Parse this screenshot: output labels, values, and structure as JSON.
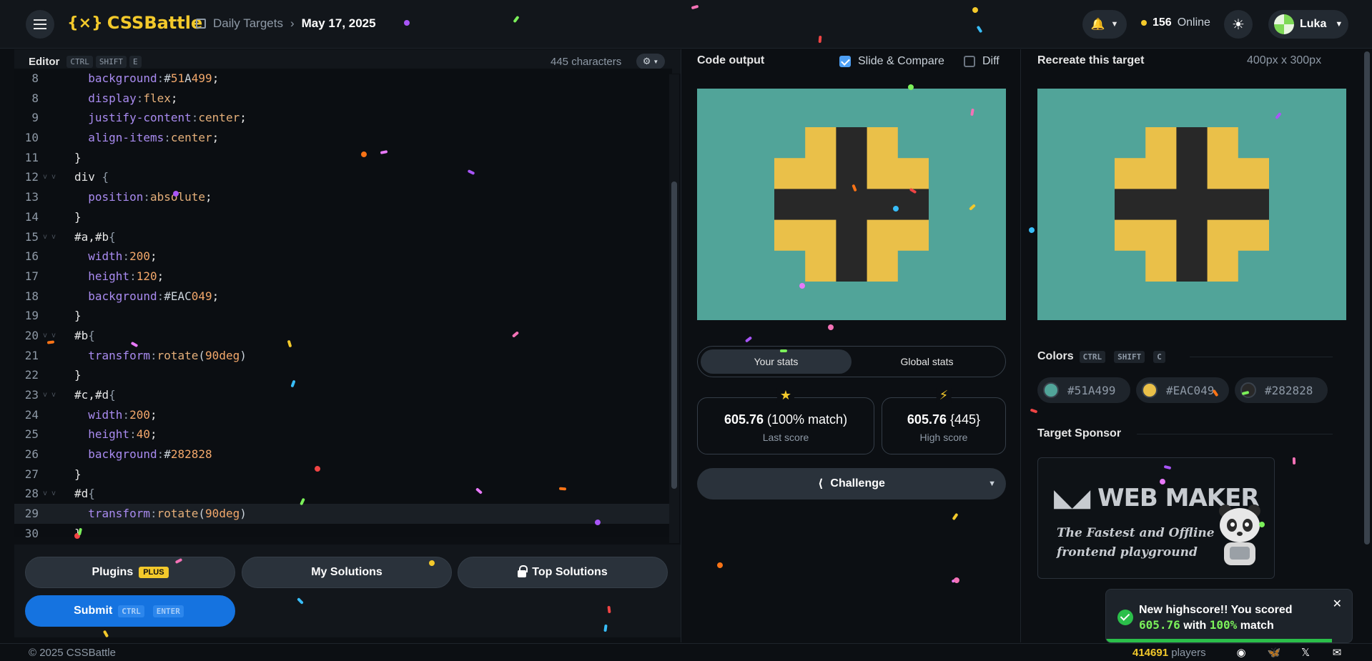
{
  "header": {
    "logo": "CSSBattle",
    "logo_mark": "{⨯}",
    "breadcrumb_section": "Daily Targets",
    "breadcrumb_date": "May 17, 2025",
    "online_count": "156",
    "online_label": "Online",
    "user_name": "Luka"
  },
  "editor": {
    "title": "Editor",
    "shortcut": [
      "CTRL",
      "SHIFT",
      "E"
    ],
    "characters": "445 characters",
    "lines": [
      {
        "n": "8",
        "text": "  background:#51A499;",
        "fold": ""
      },
      {
        "n": "8",
        "text": "  display:flex;",
        "fold": ""
      },
      {
        "n": "9",
        "text": "  justify-content:center;",
        "fold": ""
      },
      {
        "n": "10",
        "text": "  align-items:center;",
        "fold": ""
      },
      {
        "n": "11",
        "text": "}",
        "fold": ""
      },
      {
        "n": "12",
        "text": "div {",
        "fold": "v v"
      },
      {
        "n": "13",
        "text": "  position:absolute;",
        "fold": ""
      },
      {
        "n": "14",
        "text": "}",
        "fold": ""
      },
      {
        "n": "15",
        "text": "#a,#b{",
        "fold": "v v"
      },
      {
        "n": "16",
        "text": "  width:200;",
        "fold": ""
      },
      {
        "n": "17",
        "text": "  height:120;",
        "fold": ""
      },
      {
        "n": "18",
        "text": "  background:#EAC049;",
        "fold": ""
      },
      {
        "n": "19",
        "text": "}",
        "fold": ""
      },
      {
        "n": "20",
        "text": "#b{",
        "fold": "v v"
      },
      {
        "n": "21",
        "text": "  transform:rotate(90deg)",
        "fold": ""
      },
      {
        "n": "22",
        "text": "}",
        "fold": ""
      },
      {
        "n": "23",
        "text": "#c,#d{",
        "fold": "v v"
      },
      {
        "n": "24",
        "text": "  width:200;",
        "fold": ""
      },
      {
        "n": "25",
        "text": "  height:40;",
        "fold": ""
      },
      {
        "n": "26",
        "text": "  background:#282828",
        "fold": ""
      },
      {
        "n": "27",
        "text": "}",
        "fold": ""
      },
      {
        "n": "28",
        "text": "#d{",
        "fold": "v v"
      },
      {
        "n": "29",
        "text": "  transform:rotate(90deg)",
        "fold": ""
      },
      {
        "n": "30",
        "text": "}",
        "fold": ""
      }
    ],
    "active_line": "29"
  },
  "actions": {
    "plugins": "Plugins",
    "plugins_badge": "PLUS",
    "my_solutions": "My Solutions",
    "top_solutions": "Top Solutions",
    "submit": "Submit",
    "submit_shortcut": [
      "CTRL",
      "ENTER"
    ]
  },
  "output": {
    "title": "Code output",
    "slide_compare": "Slide & Compare",
    "diff": "Diff",
    "tab_your": "Your stats",
    "tab_global": "Global stats",
    "last_score_value": "605.76",
    "last_score_match": "(100% match)",
    "last_score_label": "Last score",
    "high_score_value": "605.76",
    "high_score_chars": "{445}",
    "high_score_label": "High score",
    "challenge": "Challenge"
  },
  "target": {
    "title": "Recreate this target",
    "dimensions": "400px x 300px",
    "colors_title": "Colors",
    "colors_shortcut": [
      "CTRL",
      "SHIFT",
      "C"
    ],
    "colors": [
      {
        "hex": "#51A499",
        "color": "#51A499"
      },
      {
        "hex": "#EAC049",
        "color": "#EAC049"
      },
      {
        "hex": "#282828",
        "color": "#282828"
      }
    ],
    "sponsor_title": "Target Sponsor",
    "sponsor_brand": "WEB MAKER",
    "sponsor_tagline_1": "The Fastest and Offline",
    "sponsor_tagline_2": "frontend playground"
  },
  "toast": {
    "line1": "New highscore!! You scored",
    "score": "605.76",
    "with": "with",
    "match": "100%",
    "suffix": "match"
  },
  "footer": {
    "copyright": "© 2025 CSSBattle",
    "players_count": "414691",
    "players_label": "players"
  }
}
